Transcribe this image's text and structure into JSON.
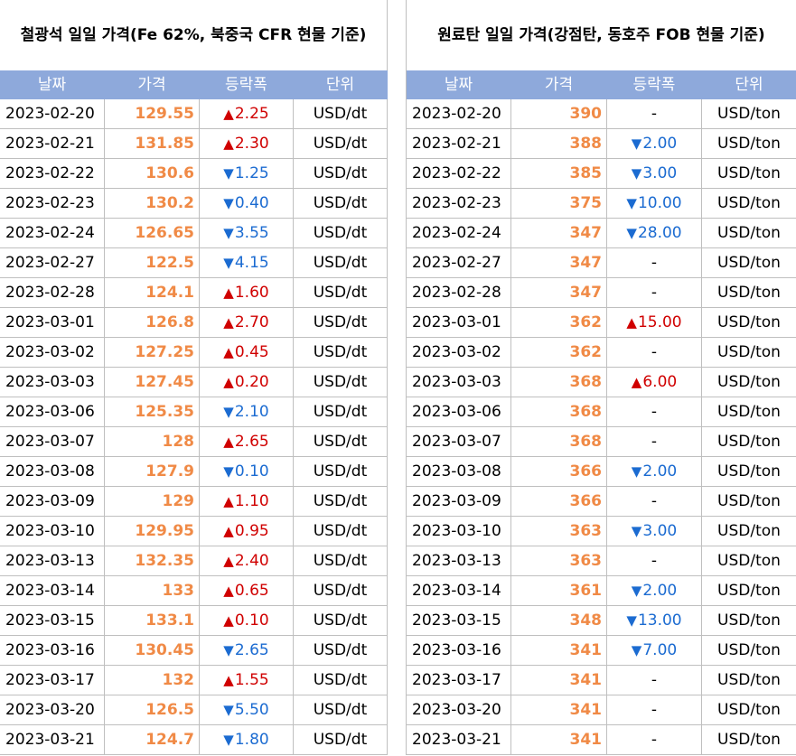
{
  "colors": {
    "header_bg": "#8EA9DB",
    "header_text": "#FFFFFF",
    "grid": "#BFBFBF",
    "price": "#F08A46",
    "up": "#D00000",
    "down": "#1B6BD1"
  },
  "iron_ore": {
    "title": "철광석 일일 가격(Fe 62%, 북중국 CFR 현물 기준)",
    "headers": [
      "날짜",
      "가격",
      "등락폭",
      "단위"
    ],
    "unit": "USD/dt",
    "rows": [
      {
        "date": "2023-02-20",
        "price": "129.55",
        "icon": "up-triangle-icon",
        "change": "2.25"
      },
      {
        "date": "2023-02-21",
        "price": "131.85",
        "icon": "up-triangle-icon",
        "change": "2.30"
      },
      {
        "date": "2023-02-22",
        "price": "130.6",
        "icon": "down-triangle-icon",
        "change": "1.25"
      },
      {
        "date": "2023-02-23",
        "price": "130.2",
        "icon": "down-triangle-icon",
        "change": "0.40"
      },
      {
        "date": "2023-02-24",
        "price": "126.65",
        "icon": "down-triangle-icon",
        "change": "3.55"
      },
      {
        "date": "2023-02-27",
        "price": "122.5",
        "icon": "down-triangle-icon",
        "change": "4.15"
      },
      {
        "date": "2023-02-28",
        "price": "124.1",
        "icon": "up-triangle-icon",
        "change": "1.60"
      },
      {
        "date": "2023-03-01",
        "price": "126.8",
        "icon": "up-triangle-icon",
        "change": "2.70"
      },
      {
        "date": "2023-03-02",
        "price": "127.25",
        "icon": "up-triangle-icon",
        "change": "0.45"
      },
      {
        "date": "2023-03-03",
        "price": "127.45",
        "icon": "up-triangle-icon",
        "change": "0.20"
      },
      {
        "date": "2023-03-06",
        "price": "125.35",
        "icon": "down-triangle-icon",
        "change": "2.10"
      },
      {
        "date": "2023-03-07",
        "price": "128",
        "icon": "up-triangle-icon",
        "change": "2.65"
      },
      {
        "date": "2023-03-08",
        "price": "127.9",
        "icon": "down-triangle-icon",
        "change": "0.10"
      },
      {
        "date": "2023-03-09",
        "price": "129",
        "icon": "up-triangle-icon",
        "change": "1.10"
      },
      {
        "date": "2023-03-10",
        "price": "129.95",
        "icon": "up-triangle-icon",
        "change": "0.95"
      },
      {
        "date": "2023-03-13",
        "price": "132.35",
        "icon": "up-triangle-icon",
        "change": "2.40"
      },
      {
        "date": "2023-03-14",
        "price": "133",
        "icon": "up-triangle-icon",
        "change": "0.65"
      },
      {
        "date": "2023-03-15",
        "price": "133.1",
        "icon": "up-triangle-icon",
        "change": "0.10"
      },
      {
        "date": "2023-03-16",
        "price": "130.45",
        "icon": "down-triangle-icon",
        "change": "2.65"
      },
      {
        "date": "2023-03-17",
        "price": "132",
        "icon": "up-triangle-icon",
        "change": "1.55"
      },
      {
        "date": "2023-03-20",
        "price": "126.5",
        "icon": "down-triangle-icon",
        "change": "5.50"
      },
      {
        "date": "2023-03-21",
        "price": "124.7",
        "icon": "down-triangle-icon",
        "change": "1.80"
      }
    ]
  },
  "coking_coal": {
    "title": "원료탄 일일 가격(강점탄, 동호주 FOB 현물 기준)",
    "headers": [
      "날짜",
      "가격",
      "등락폭",
      "단위"
    ],
    "unit": "USD/ton",
    "rows": [
      {
        "date": "2023-02-20",
        "price": "390",
        "icon": "",
        "change": "-"
      },
      {
        "date": "2023-02-21",
        "price": "388",
        "icon": "down-triangle-icon",
        "change": "2.00"
      },
      {
        "date": "2023-02-22",
        "price": "385",
        "icon": "down-triangle-icon",
        "change": "3.00"
      },
      {
        "date": "2023-02-23",
        "price": "375",
        "icon": "down-triangle-icon",
        "change": "10.00"
      },
      {
        "date": "2023-02-24",
        "price": "347",
        "icon": "down-triangle-icon",
        "change": "28.00"
      },
      {
        "date": "2023-02-27",
        "price": "347",
        "icon": "",
        "change": "-"
      },
      {
        "date": "2023-02-28",
        "price": "347",
        "icon": "",
        "change": "-"
      },
      {
        "date": "2023-03-01",
        "price": "362",
        "icon": "up-triangle-icon",
        "change": "15.00"
      },
      {
        "date": "2023-03-02",
        "price": "362",
        "icon": "",
        "change": "-"
      },
      {
        "date": "2023-03-03",
        "price": "368",
        "icon": "up-triangle-icon",
        "change": "6.00"
      },
      {
        "date": "2023-03-06",
        "price": "368",
        "icon": "",
        "change": "-"
      },
      {
        "date": "2023-03-07",
        "price": "368",
        "icon": "",
        "change": "-"
      },
      {
        "date": "2023-03-08",
        "price": "366",
        "icon": "down-triangle-icon",
        "change": "2.00"
      },
      {
        "date": "2023-03-09",
        "price": "366",
        "icon": "",
        "change": "-"
      },
      {
        "date": "2023-03-10",
        "price": "363",
        "icon": "down-triangle-icon",
        "change": "3.00"
      },
      {
        "date": "2023-03-13",
        "price": "363",
        "icon": "",
        "change": "-"
      },
      {
        "date": "2023-03-14",
        "price": "361",
        "icon": "down-triangle-icon",
        "change": "2.00"
      },
      {
        "date": "2023-03-15",
        "price": "348",
        "icon": "down-triangle-icon",
        "change": "13.00"
      },
      {
        "date": "2023-03-16",
        "price": "341",
        "icon": "down-triangle-icon",
        "change": "7.00"
      },
      {
        "date": "2023-03-17",
        "price": "341",
        "icon": "",
        "change": "-"
      },
      {
        "date": "2023-03-20",
        "price": "341",
        "icon": "",
        "change": "-"
      },
      {
        "date": "2023-03-21",
        "price": "341",
        "icon": "",
        "change": "-"
      }
    ]
  }
}
